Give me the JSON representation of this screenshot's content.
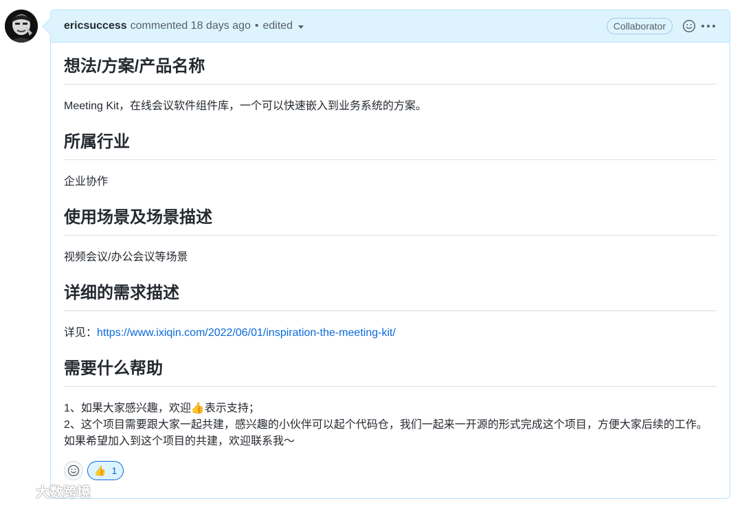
{
  "comment": {
    "author": "ericsuccess",
    "action": "commented 18 days ago",
    "edited": "edited",
    "badge": "Collaborator"
  },
  "sections": [
    {
      "heading": "想法/方案/产品名称",
      "text": "Meeting Kit，在线会议软件组件库，一个可以快速嵌入到业务系统的方案。"
    },
    {
      "heading": "所属行业",
      "text": "企业协作"
    },
    {
      "heading": "使用场景及场景描述",
      "text": "视频会议/办公会议等场景"
    },
    {
      "heading": "详细的需求描述",
      "text_prefix": "详见：",
      "link": "https://www.ixiqin.com/2022/06/01/inspiration-the-meeting-kit/"
    },
    {
      "heading": "需要什么帮助",
      "line1_a": "1、如果大家感兴趣，欢迎",
      "line1_emoji": "👍",
      "line1_b": "表示支持；",
      "line2": "2、这个项目需要跟大家一起共建，感兴趣的小伙伴可以起个代码仓，我们一起来一开源的形式完成这个项目，方便大家后续的工作。如果希望加入到这个项目的共建，欢迎联系我～"
    }
  ],
  "reactions": [
    {
      "emoji": "👍",
      "count": "1"
    }
  ],
  "watermark": "大数跨境",
  "icons": {
    "avatar": "avatar",
    "header_smiley": "smiley-icon",
    "header_more": "kebab-horizontal-icon",
    "add_reaction": "smiley-icon"
  }
}
